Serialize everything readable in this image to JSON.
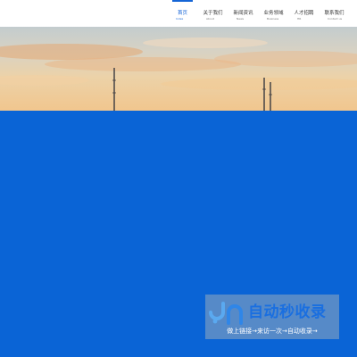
{
  "nav": {
    "items": [
      {
        "label": "首页",
        "sublabel": "Index",
        "active": true
      },
      {
        "label": "关于我们",
        "sublabel": "About",
        "active": false
      },
      {
        "label": "新闻资讯",
        "sublabel": "News",
        "active": false
      },
      {
        "label": "业务领域",
        "sublabel": "Business",
        "active": false
      },
      {
        "label": "人才招聘",
        "sublabel": "HR",
        "active": false
      },
      {
        "label": "联系我们",
        "sublabel": "Contact us",
        "active": false
      }
    ]
  },
  "colors": {
    "accent": "#1565d6",
    "main_block": "#0a64d6",
    "badge_title": "#1a6fe0"
  },
  "watermark": {
    "logo_icon": "jn-logo-icon",
    "title": "自动秒收录",
    "tagline": "做上链接→来访一次→自动收录→"
  }
}
